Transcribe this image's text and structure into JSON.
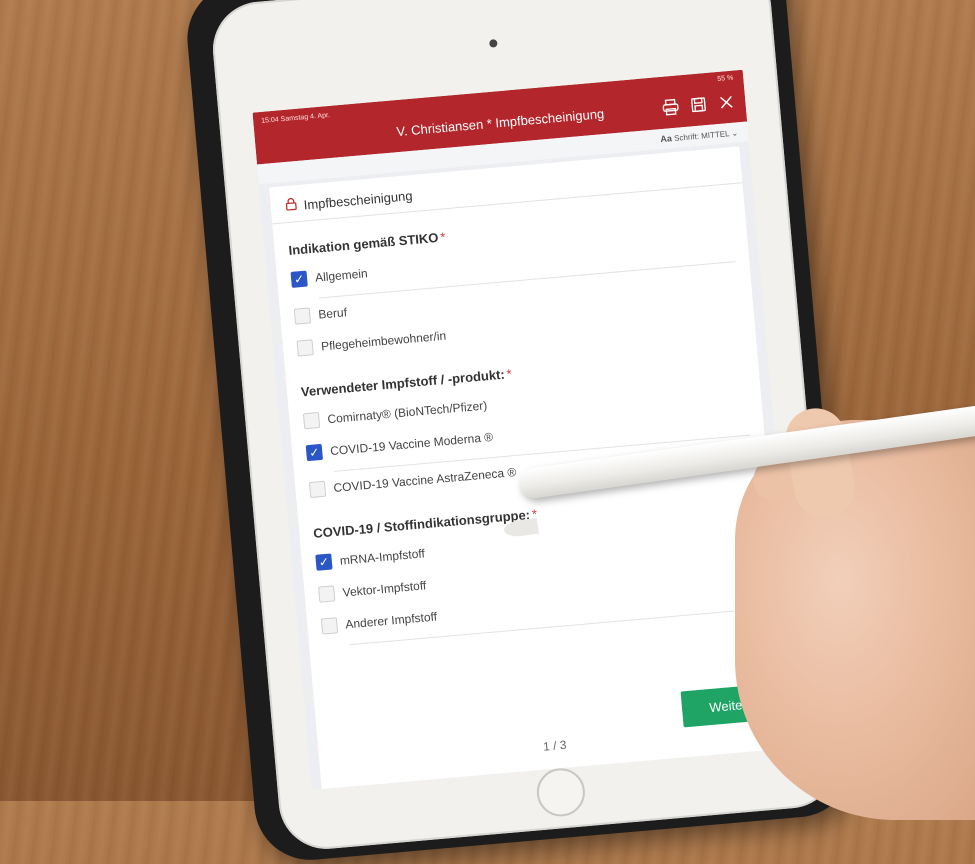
{
  "header": {
    "status_time": "15:04  Samstag 4. Apr.",
    "status_battery": "55 %",
    "title": "V. Christiansen * Impfbescheinigung"
  },
  "subbar": {
    "font_prefix": "Aa",
    "font_label": "Schrift: MITTEL"
  },
  "form": {
    "section_title": "Impfbescheinigung",
    "groups": [
      {
        "label": "Indikation gemäß STIKO",
        "required": "*",
        "options": [
          {
            "label": "Allgemein",
            "checked": true
          },
          {
            "label": "Beruf",
            "checked": false
          },
          {
            "label": "Pflegeheimbewohner/in",
            "checked": false
          }
        ]
      },
      {
        "label": "Verwendeter Impfstoff / -produkt:",
        "required": "*",
        "options": [
          {
            "label": "Comirnaty® (BioNTech/Pfizer)",
            "checked": false
          },
          {
            "label": "COVID-19 Vaccine Moderna ®",
            "checked": true
          },
          {
            "label": "COVID-19 Vaccine AstraZeneca ®",
            "checked": false
          }
        ]
      },
      {
        "label": "COVID-19 / Stoffindikationsgruppe:",
        "required": "*",
        "options": [
          {
            "label": "mRNA-Impfstoff",
            "checked": true
          },
          {
            "label": "Vektor-Impfstoff",
            "checked": false
          },
          {
            "label": "Anderer Impfstoff",
            "checked": false
          }
        ]
      }
    ]
  },
  "footer": {
    "page_indicator": "1 / 3",
    "next_label": "Weiter"
  },
  "colors": {
    "header": "#b3262b",
    "checkbox": "#2a56c6",
    "button": "#1fa465"
  }
}
